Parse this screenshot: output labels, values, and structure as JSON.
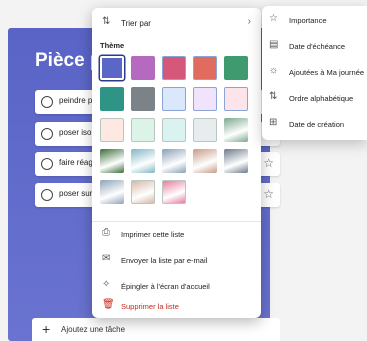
{
  "list": {
    "title": "Pièce pr",
    "tasks": [
      {
        "label": "peindre p"
      },
      {
        "label": "poser iso"
      },
      {
        "label": "faire réag"
      },
      {
        "label": "poser sur"
      }
    ],
    "add_task_label": "Ajoutez une tâche"
  },
  "menu": {
    "sort_label": "Trier par",
    "theme_label": "Thème",
    "swatches": [
      {
        "color": "#5a67c7",
        "selected": true
      },
      {
        "color": "#b56ac0"
      },
      {
        "color": "#d5577a"
      },
      {
        "color": "#e06b5e"
      },
      {
        "color": "#3f9b6f"
      },
      {
        "color": "#2e9586"
      },
      {
        "color": "#7b8388"
      },
      {
        "color": "#dbe7fb"
      },
      {
        "color": "#f0e3fb"
      },
      {
        "color": "#fde3ea"
      },
      {
        "color": "#fde8e2"
      },
      {
        "color": "#dcf3e8"
      },
      {
        "color": "#daf2f0"
      },
      {
        "color": "#e8ecef"
      },
      {
        "color": "#7aa88c",
        "image": "photo-palm"
      },
      {
        "color": "#3b6e3a",
        "image": "photo-leaves"
      },
      {
        "color": "#7eb7c5",
        "image": "photo-beach"
      },
      {
        "color": "#89a0b5",
        "image": "photo-mountains"
      },
      {
        "color": "#c79b86",
        "image": "photo-desert"
      },
      {
        "color": "#6b7a8a",
        "image": "photo-rocks"
      },
      {
        "color": "#8ea3b7",
        "image": "photo-lighthouse"
      },
      {
        "color": "#d6b9a8",
        "image": "photo-field"
      },
      {
        "color": "#e67fa0",
        "image": "photo-pink"
      }
    ],
    "items": [
      {
        "label": "Imprimer cette liste",
        "icon": "printer-icon"
      },
      {
        "label": "Envoyer la liste par e-mail",
        "icon": "mail-icon"
      },
      {
        "label": "Épingler à l'écran d'accueil",
        "icon": "pin-icon"
      },
      {
        "label": "Supprimer la liste",
        "icon": "trash-icon",
        "danger": true
      }
    ]
  },
  "sort_submenu": [
    {
      "label": "Importance",
      "icon": "star-icon"
    },
    {
      "label": "Date d'échéance",
      "icon": "calendar-icon"
    },
    {
      "label": "Ajoutées à Ma journée",
      "icon": "sun-icon"
    },
    {
      "label": "Ordre alphabétique",
      "icon": "sort-icon"
    },
    {
      "label": "Date de création",
      "icon": "calendar-add-icon"
    }
  ],
  "colors": {
    "accent": "#5a67c7",
    "danger": "#c42b1c"
  }
}
